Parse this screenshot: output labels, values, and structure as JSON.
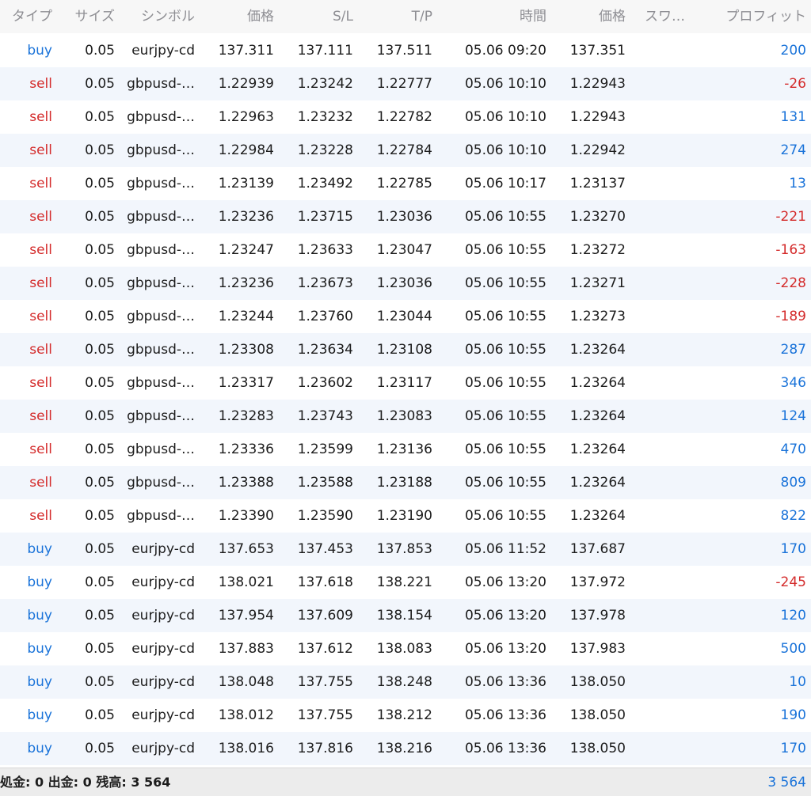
{
  "colors": {
    "buy": "#1a73d9",
    "sell": "#d42b2b",
    "profit_positive": "#1a73d9",
    "profit_negative": "#d42b2b",
    "header_text": "#8e8e93",
    "row_alt_bg": "#f2f6fc",
    "footer_bg": "#ececec"
  },
  "table": {
    "headers": {
      "type": "タイプ",
      "size": "サイズ",
      "symbol": "シンボル",
      "price": "価格",
      "sl": "S/L",
      "tp": "T/P",
      "time": "時間",
      "current_price": "価格",
      "swap": "スワ…",
      "profit": "プロフィット"
    },
    "rows": [
      {
        "type": "buy",
        "size": "0.05",
        "symbol": "eurjpy-cd",
        "price": "137.311",
        "sl": "137.111",
        "tp": "137.511",
        "time": "05.06 09:20",
        "current_price": "137.351",
        "profit": "200"
      },
      {
        "type": "sell",
        "size": "0.05",
        "symbol": "gbpusd-…",
        "price": "1.22939",
        "sl": "1.23242",
        "tp": "1.22777",
        "time": "05.06 10:10",
        "current_price": "1.22943",
        "profit": "-26"
      },
      {
        "type": "sell",
        "size": "0.05",
        "symbol": "gbpusd-…",
        "price": "1.22963",
        "sl": "1.23232",
        "tp": "1.22782",
        "time": "05.06 10:10",
        "current_price": "1.22943",
        "profit": "131"
      },
      {
        "type": "sell",
        "size": "0.05",
        "symbol": "gbpusd-…",
        "price": "1.22984",
        "sl": "1.23228",
        "tp": "1.22784",
        "time": "05.06 10:10",
        "current_price": "1.22942",
        "profit": "274"
      },
      {
        "type": "sell",
        "size": "0.05",
        "symbol": "gbpusd-…",
        "price": "1.23139",
        "sl": "1.23492",
        "tp": "1.22785",
        "time": "05.06 10:17",
        "current_price": "1.23137",
        "profit": "13"
      },
      {
        "type": "sell",
        "size": "0.05",
        "symbol": "gbpusd-…",
        "price": "1.23236",
        "sl": "1.23715",
        "tp": "1.23036",
        "time": "05.06 10:55",
        "current_price": "1.23270",
        "profit": "-221"
      },
      {
        "type": "sell",
        "size": "0.05",
        "symbol": "gbpusd-…",
        "price": "1.23247",
        "sl": "1.23633",
        "tp": "1.23047",
        "time": "05.06 10:55",
        "current_price": "1.23272",
        "profit": "-163"
      },
      {
        "type": "sell",
        "size": "0.05",
        "symbol": "gbpusd-…",
        "price": "1.23236",
        "sl": "1.23673",
        "tp": "1.23036",
        "time": "05.06 10:55",
        "current_price": "1.23271",
        "profit": "-228"
      },
      {
        "type": "sell",
        "size": "0.05",
        "symbol": "gbpusd-…",
        "price": "1.23244",
        "sl": "1.23760",
        "tp": "1.23044",
        "time": "05.06 10:55",
        "current_price": "1.23273",
        "profit": "-189"
      },
      {
        "type": "sell",
        "size": "0.05",
        "symbol": "gbpusd-…",
        "price": "1.23308",
        "sl": "1.23634",
        "tp": "1.23108",
        "time": "05.06 10:55",
        "current_price": "1.23264",
        "profit": "287"
      },
      {
        "type": "sell",
        "size": "0.05",
        "symbol": "gbpusd-…",
        "price": "1.23317",
        "sl": "1.23602",
        "tp": "1.23117",
        "time": "05.06 10:55",
        "current_price": "1.23264",
        "profit": "346"
      },
      {
        "type": "sell",
        "size": "0.05",
        "symbol": "gbpusd-…",
        "price": "1.23283",
        "sl": "1.23743",
        "tp": "1.23083",
        "time": "05.06 10:55",
        "current_price": "1.23264",
        "profit": "124"
      },
      {
        "type": "sell",
        "size": "0.05",
        "symbol": "gbpusd-…",
        "price": "1.23336",
        "sl": "1.23599",
        "tp": "1.23136",
        "time": "05.06 10:55",
        "current_price": "1.23264",
        "profit": "470"
      },
      {
        "type": "sell",
        "size": "0.05",
        "symbol": "gbpusd-…",
        "price": "1.23388",
        "sl": "1.23588",
        "tp": "1.23188",
        "time": "05.06 10:55",
        "current_price": "1.23264",
        "profit": "809"
      },
      {
        "type": "sell",
        "size": "0.05",
        "symbol": "gbpusd-…",
        "price": "1.23390",
        "sl": "1.23590",
        "tp": "1.23190",
        "time": "05.06 10:55",
        "current_price": "1.23264",
        "profit": "822"
      },
      {
        "type": "buy",
        "size": "0.05",
        "symbol": "eurjpy-cd",
        "price": "137.653",
        "sl": "137.453",
        "tp": "137.853",
        "time": "05.06 11:52",
        "current_price": "137.687",
        "profit": "170"
      },
      {
        "type": "buy",
        "size": "0.05",
        "symbol": "eurjpy-cd",
        "price": "138.021",
        "sl": "137.618",
        "tp": "138.221",
        "time": "05.06 13:20",
        "current_price": "137.972",
        "profit": "-245"
      },
      {
        "type": "buy",
        "size": "0.05",
        "symbol": "eurjpy-cd",
        "price": "137.954",
        "sl": "137.609",
        "tp": "138.154",
        "time": "05.06 13:20",
        "current_price": "137.978",
        "profit": "120"
      },
      {
        "type": "buy",
        "size": "0.05",
        "symbol": "eurjpy-cd",
        "price": "137.883",
        "sl": "137.612",
        "tp": "138.083",
        "time": "05.06 13:20",
        "current_price": "137.983",
        "profit": "500"
      },
      {
        "type": "buy",
        "size": "0.05",
        "symbol": "eurjpy-cd",
        "price": "138.048",
        "sl": "137.755",
        "tp": "138.248",
        "time": "05.06 13:36",
        "current_price": "138.050",
        "profit": "10"
      },
      {
        "type": "buy",
        "size": "0.05",
        "symbol": "eurjpy-cd",
        "price": "138.012",
        "sl": "137.755",
        "tp": "138.212",
        "time": "05.06 13:36",
        "current_price": "138.050",
        "profit": "190"
      },
      {
        "type": "buy",
        "size": "0.05",
        "symbol": "eurjpy-cd",
        "price": "138.016",
        "sl": "137.816",
        "tp": "138.216",
        "time": "05.06 13:36",
        "current_price": "138.050",
        "profit": "170"
      }
    ]
  },
  "footer": {
    "summary": "処金: 0 出金: 0 残高: 3 564",
    "total_profit": "3 564"
  }
}
